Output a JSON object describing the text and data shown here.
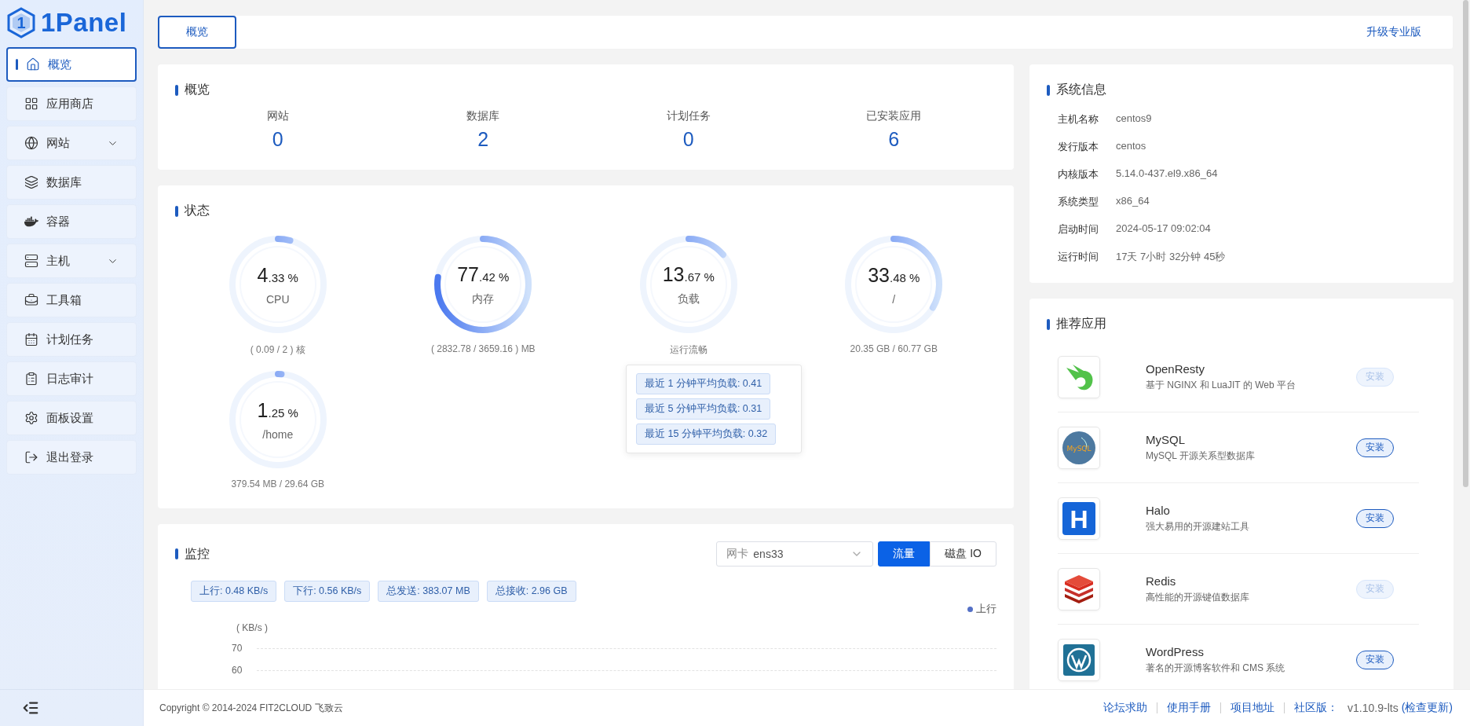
{
  "logo": {
    "mark": "1",
    "text": "1Panel"
  },
  "sidebar": {
    "items": [
      {
        "label": "概览",
        "selected": true,
        "expandable": false
      },
      {
        "label": "应用商店",
        "selected": false,
        "expandable": false
      },
      {
        "label": "网站",
        "selected": false,
        "expandable": true
      },
      {
        "label": "数据库",
        "selected": false,
        "expandable": false
      },
      {
        "label": "容器",
        "selected": false,
        "expandable": false
      },
      {
        "label": "主机",
        "selected": false,
        "expandable": true
      },
      {
        "label": "工具箱",
        "selected": false,
        "expandable": false
      },
      {
        "label": "计划任务",
        "selected": false,
        "expandable": false
      },
      {
        "label": "日志审计",
        "selected": false,
        "expandable": false
      },
      {
        "label": "面板设置",
        "selected": false,
        "expandable": false
      },
      {
        "label": "退出登录",
        "selected": false,
        "expandable": false
      }
    ]
  },
  "tabs": [
    {
      "label": "概览",
      "selected": true
    }
  ],
  "upgrade_link": "升级专业版",
  "overview": {
    "title": "概览",
    "stats": [
      {
        "label": "网站",
        "value": "0"
      },
      {
        "label": "数据库",
        "value": "2"
      },
      {
        "label": "计划任务",
        "value": "0"
      },
      {
        "label": "已安装应用",
        "value": "6"
      }
    ]
  },
  "status": {
    "title": "状态",
    "gauges": [
      {
        "int": "4",
        "frac": ".33 %",
        "label": "CPU",
        "detail": "( 0.09 / 2 ) 核",
        "level": 0.0433
      },
      {
        "int": "77",
        "frac": ".42 %",
        "label": "内存",
        "detail": "( 2832.78 / 3659.16 ) MB",
        "level": 0.7742
      },
      {
        "int": "13",
        "frac": ".67 %",
        "label": "负载",
        "detail": "运行流畅",
        "level": 0.1367
      },
      {
        "int": "33",
        "frac": ".48 %",
        "label": "/",
        "detail": "20.35 GB / 60.77 GB",
        "level": 0.3348
      },
      {
        "int": "1",
        "frac": ".25 %",
        "label": "/home",
        "detail": "379.54 MB / 29.64 GB",
        "level": 0.0125
      }
    ],
    "load_popup": [
      "最近 1 分钟平均负载: 0.41",
      "最近 5 分钟平均负载: 0.31",
      "最近 15 分钟平均负载: 0.32"
    ]
  },
  "monitor": {
    "title": "监控",
    "nic_select": {
      "label": "网卡",
      "value": "ens33"
    },
    "modes": [
      {
        "label": "流量",
        "selected": true
      },
      {
        "label": "磁盘 IO",
        "selected": false
      }
    ],
    "tags": [
      "上行: 0.48 KB/s",
      "下行: 0.56 KB/s",
      "总发送: 383.07 MB",
      "总接收: 2.96 GB"
    ],
    "legend": [
      {
        "label": "上行",
        "color": "#5470c6"
      }
    ],
    "unit": "( KB/s )",
    "tick_labels": [
      "70",
      "60"
    ]
  },
  "system_info": {
    "title": "系统信息",
    "rows": [
      {
        "label": "主机名称",
        "value": "centos9"
      },
      {
        "label": "发行版本",
        "value": "centos"
      },
      {
        "label": "内核版本",
        "value": "5.14.0-437.el9.x86_64"
      },
      {
        "label": "系统类型",
        "value": "x86_64"
      },
      {
        "label": "启动时间",
        "value": "2024-05-17 09:02:04"
      },
      {
        "label": "运行时间",
        "value": "17天 7小时 32分钟 45秒"
      }
    ]
  },
  "recommended": {
    "title": "推荐应用",
    "apps": [
      {
        "name": "OpenResty",
        "desc": "基于 NGINX 和 LuaJIT 的 Web 平台",
        "kind": "bird",
        "button": "安装",
        "disabled": true
      },
      {
        "name": "MySQL",
        "desc": "MySQL 开源关系型数据库",
        "kind": "dolphin",
        "mark": "MySQL",
        "button": "安装",
        "disabled": false
      },
      {
        "name": "Halo",
        "desc": "强大易用的开源建站工具",
        "kind": "letter",
        "mark": "H",
        "button": "安装",
        "disabled": false
      },
      {
        "name": "Redis",
        "desc": "高性能的开源键值数据库",
        "kind": "stack",
        "button": "安装",
        "disabled": true
      },
      {
        "name": "WordPress",
        "desc": "著名的开源博客软件和 CMS 系统",
        "kind": "wp",
        "button": "安装",
        "disabled": false
      }
    ]
  },
  "footer": {
    "copyright": "Copyright © 2014-2024 FIT2CLOUD 飞致云",
    "links": [
      "论坛求助",
      "使用手册",
      "项目地址"
    ],
    "edition": "社区版：",
    "version": "v1.10.9-lts",
    "update_link": "(检查更新)"
  }
}
